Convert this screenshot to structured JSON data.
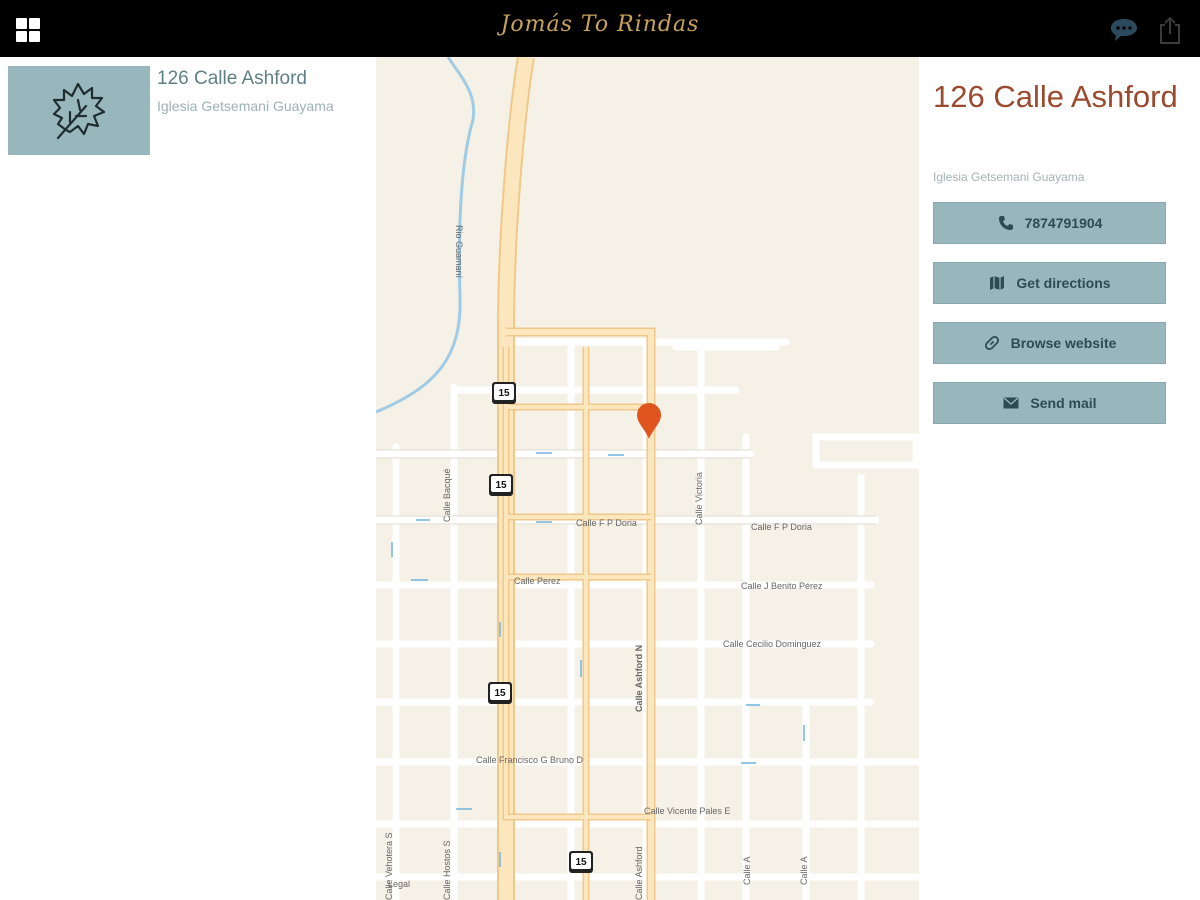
{
  "header": {
    "title": "Jomás To Rindas",
    "menu_icon": "grid-icon",
    "chat_icon": "chat-bubble-icon",
    "share_icon": "share-icon",
    "title_color": "#c9a25b"
  },
  "list": {
    "items": [
      {
        "title": "126 Calle Ashford",
        "subtitle": "Iglesia Getsemani Guayama",
        "thumbnail_icon": "leaf-icon"
      }
    ]
  },
  "map": {
    "pin_color": "#e0541f",
    "route_shields": [
      "15",
      "15",
      "15",
      "15"
    ],
    "street_labels": {
      "rio": "Rio Guamaní",
      "fp_doria_1": "Calle F P Doria",
      "fp_doria_2": "Calle F P Doria",
      "perez": "Calle Perez",
      "benito": "Calle J Benito Pérez",
      "cecilio": "Calle Cecilio Dominguez",
      "francisco": "Calle Francisco G Bruno D",
      "vicente": "Calle Vicente Pales E",
      "ashford": "Calle Ashford N",
      "victoria": "Calle Victoria",
      "vertical_left": "Calle Bacqué",
      "bottom_1": "Calle Vehotera S",
      "bottom_2": "Calle Hostos S",
      "bottom_3": "Calle Ashford",
      "bottom_4": "Calle A",
      "bottom_5": "Calle A",
      "legal": "Legal"
    }
  },
  "detail": {
    "title": "126 Calle Ashford",
    "subtitle": "Iglesia Getsemani Guayama",
    "title_color": "#9b4a2e",
    "button_color": "#97b7bd",
    "buttons": {
      "phone": {
        "label": "7874791904",
        "icon": "phone-icon"
      },
      "directions": {
        "label": "Get directions",
        "icon": "map-icon"
      },
      "website": {
        "label": "Browse website",
        "icon": "link-icon"
      },
      "mail": {
        "label": "Send mail",
        "icon": "envelope-icon"
      }
    }
  }
}
